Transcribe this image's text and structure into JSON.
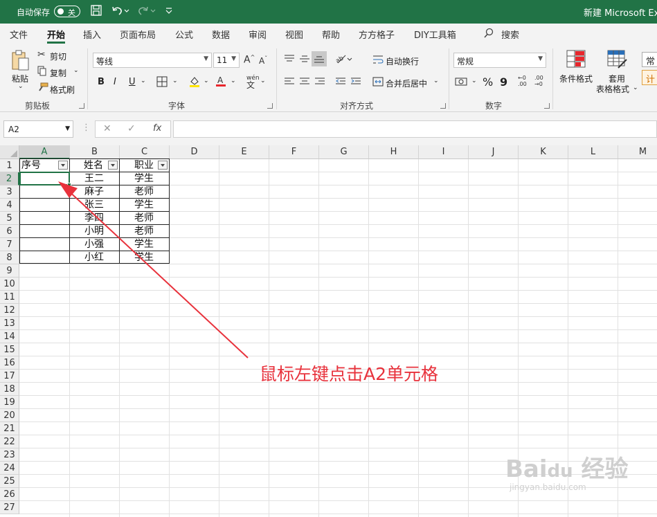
{
  "titlebar": {
    "autosave_label": "自动保存",
    "autosave_state": "关",
    "title": "新建 Microsoft Exc"
  },
  "tabs": [
    "文件",
    "开始",
    "插入",
    "页面布局",
    "公式",
    "数据",
    "审阅",
    "视图",
    "帮助",
    "方方格子",
    "DIY工具箱"
  ],
  "search_label": "搜索",
  "ribbon": {
    "clipboard": {
      "paste": "粘贴",
      "cut": "剪切",
      "copy": "复制",
      "format_painter": "格式刷",
      "label": "剪贴板"
    },
    "font": {
      "name": "等线",
      "size": "11",
      "bold": "B",
      "italic": "I",
      "underline": "U",
      "label": "字体"
    },
    "alignment": {
      "wrap": "自动换行",
      "merge": "合并后居中",
      "label": "对齐方式"
    },
    "number": {
      "format": "常规",
      "label": "数字",
      "percent": "%",
      "comma": "9"
    },
    "styles": {
      "conditional": "条件格式",
      "table_format_line1": "套用",
      "table_format_line2": "表格格式",
      "cell_style": "常",
      "calc": "计"
    }
  },
  "formula_bar": {
    "name_box": "A2",
    "fx": "fx",
    "value": ""
  },
  "columns": [
    "A",
    "B",
    "C",
    "D",
    "E",
    "F",
    "G",
    "H",
    "I",
    "J",
    "K",
    "L",
    "M"
  ],
  "rows": [
    "1",
    "2",
    "3",
    "4",
    "5",
    "6",
    "7",
    "8",
    "9",
    "10",
    "11",
    "12",
    "13",
    "14",
    "15",
    "16",
    "17",
    "18",
    "19",
    "20",
    "21",
    "22",
    "23",
    "24",
    "25",
    "26",
    "27"
  ],
  "table": {
    "headers": [
      "序号",
      "姓名",
      "职业"
    ],
    "names": [
      "王二",
      "麻子",
      "张三",
      "李四",
      "小明",
      "小强",
      "小红"
    ],
    "jobs": [
      "学生",
      "老师",
      "学生",
      "老师",
      "老师",
      "学生",
      "学生"
    ]
  },
  "annotation": "鼠标左键点击A2单元格",
  "colors": {
    "excel_green": "#217346",
    "annotation_red": "#e8323c"
  }
}
